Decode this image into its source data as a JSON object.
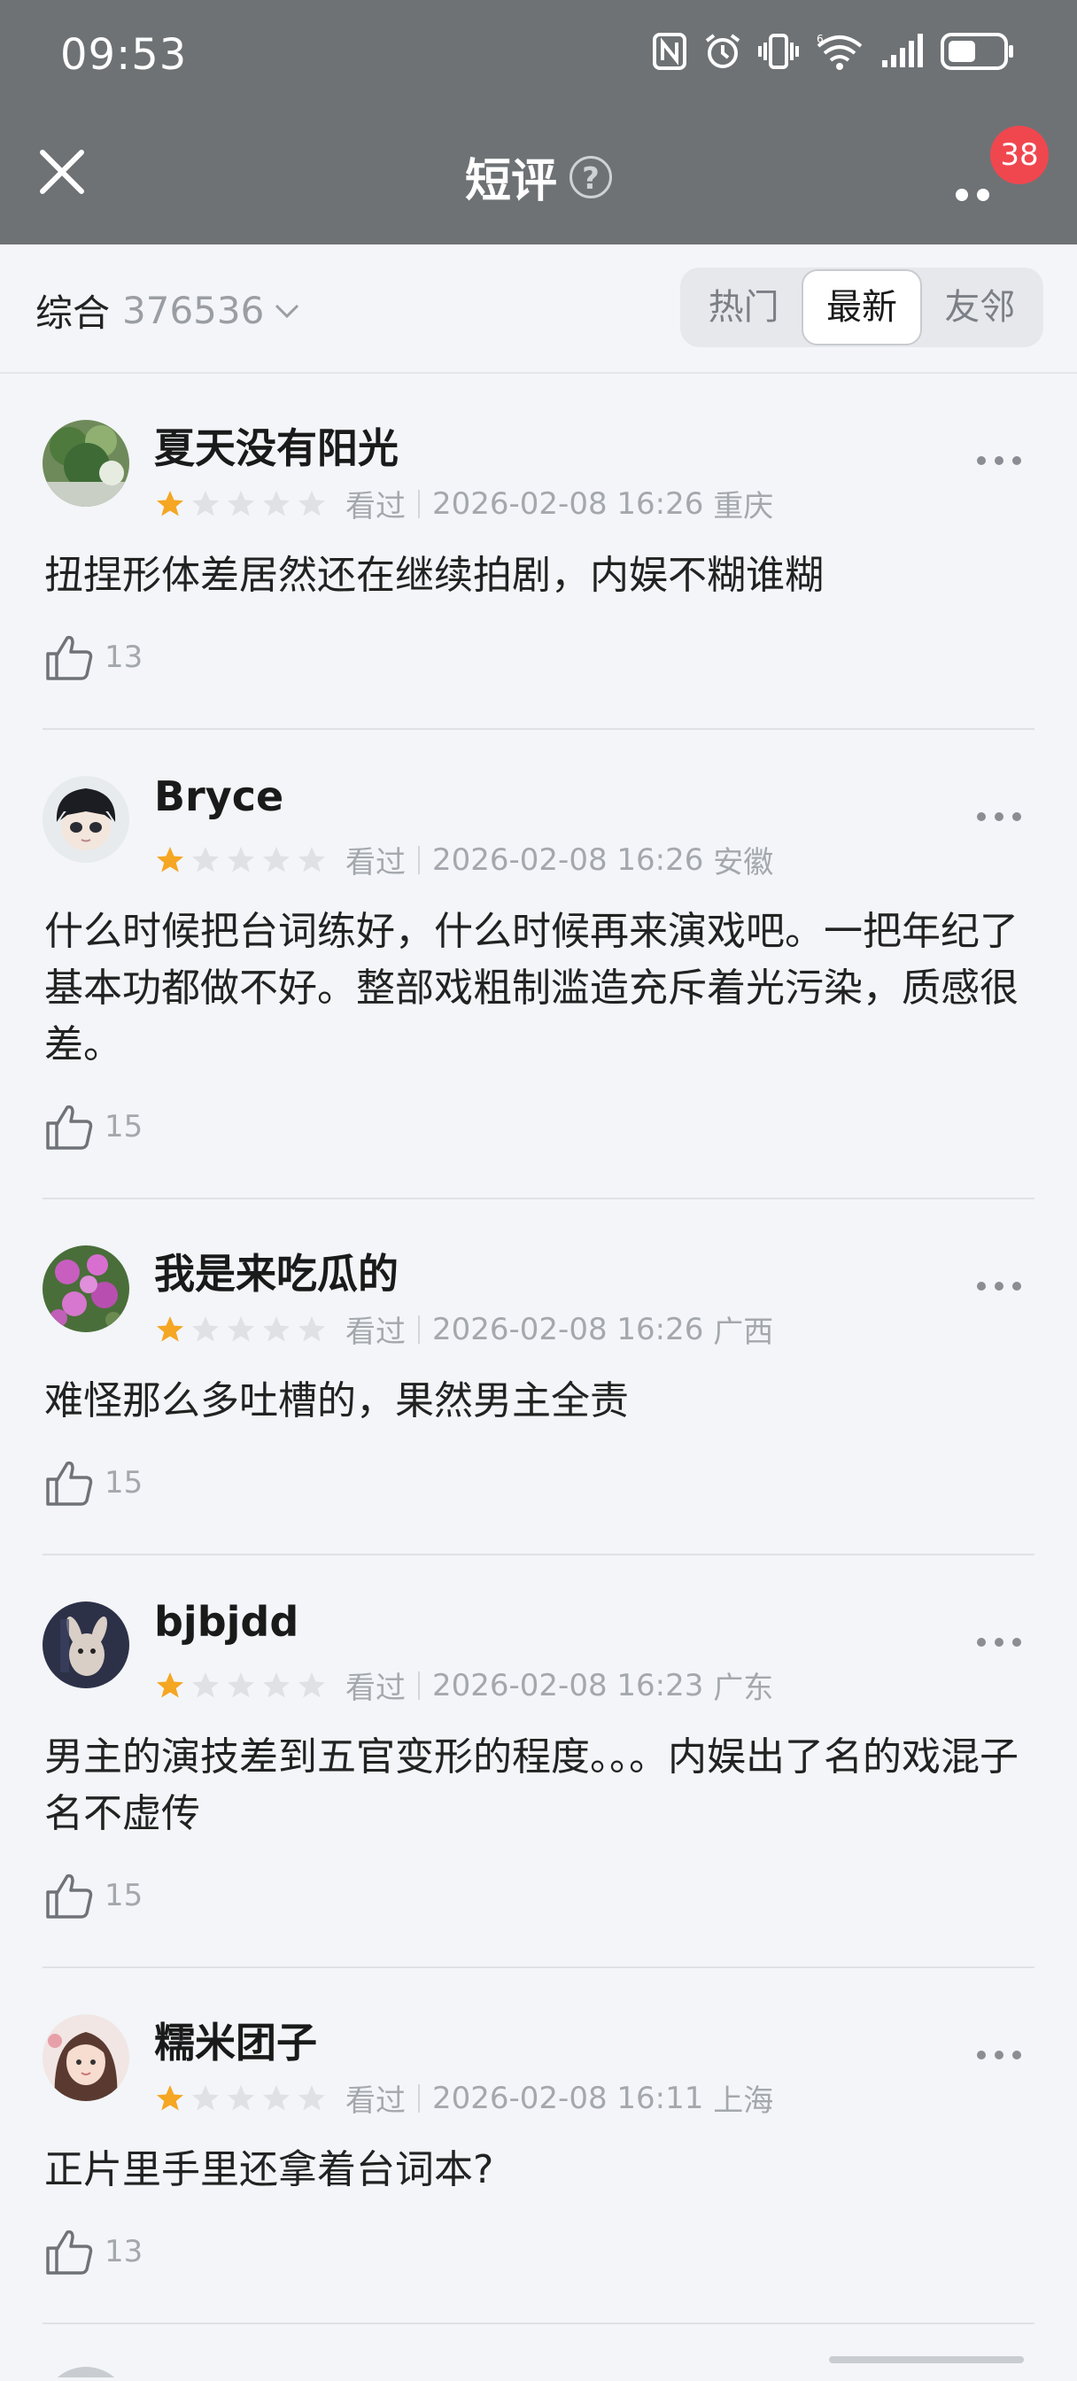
{
  "status_bar": {
    "time": "09:53"
  },
  "nav": {
    "title": "短评",
    "badge_count": "38"
  },
  "filter": {
    "sort_label": "综合",
    "total_count": "376536",
    "tabs": [
      "热门",
      "最新",
      "友邻"
    ],
    "active_tab": "最新"
  },
  "reviews": [
    {
      "name": "夏天没有阳光",
      "rating": 1,
      "status": "看过",
      "datetime": "2026-02-08 16:26",
      "location": "重庆",
      "content": "扭捏形体差居然还在继续拍剧，内娱不糊谁糊",
      "likes": "13"
    },
    {
      "name": "Bryce",
      "rating": 1,
      "status": "看过",
      "datetime": "2026-02-08 16:26",
      "location": "安徽",
      "content": "什么时候把台词练好，什么时候再来演戏吧。一把年纪了基本功都做不好。整部戏粗制滥造充斥着光污染，质感很差。",
      "likes": "15"
    },
    {
      "name": "我是来吃瓜的",
      "rating": 1,
      "status": "看过",
      "datetime": "2026-02-08 16:26",
      "location": "广西",
      "content": "难怪那么多吐槽的，果然男主全责",
      "likes": "15"
    },
    {
      "name": "bjbjdd",
      "rating": 1,
      "status": "看过",
      "datetime": "2026-02-08 16:23",
      "location": "广东",
      "content": "男主的演技差到五官变形的程度。。。内娱出了名的戏混子名不虚传",
      "likes": "15"
    },
    {
      "name": "糯米团子",
      "rating": 1,
      "status": "看过",
      "datetime": "2026-02-08 16:11",
      "location": "上海",
      "content": "正片里手里还拿着台词本?",
      "likes": "13"
    }
  ],
  "colors": {
    "header_bg": "#6e7275",
    "star": "#f5a623",
    "badge": "#f0474f"
  }
}
